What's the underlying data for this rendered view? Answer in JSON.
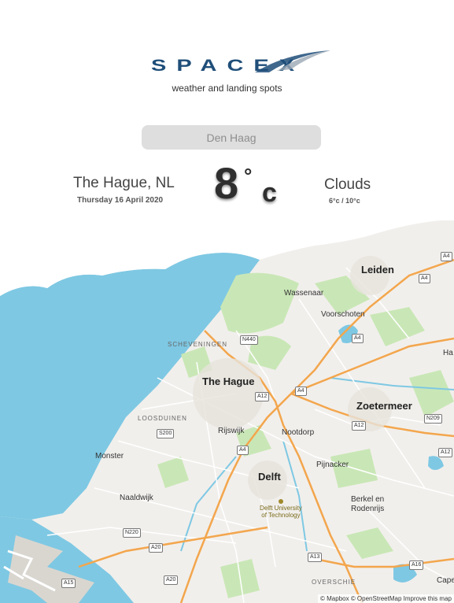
{
  "header": {
    "logo_text": "SPACEX",
    "tagline": "weather and landing spots"
  },
  "search": {
    "placeholder": "Den Haag"
  },
  "weather": {
    "city": "The Hague, NL",
    "date": "Thursday 16 April 2020",
    "temperature": "8",
    "degree_symbol": "°",
    "unit": "c",
    "condition": "Clouds",
    "range": "6°c / 10°c"
  },
  "map": {
    "cities": {
      "the_hague": "The Hague",
      "leiden": "Leiden",
      "zoetermeer": "Zoetermeer",
      "delft": "Delft"
    },
    "towns": {
      "wassenaar": "Wassenaar",
      "voorschoten": "Voorschoten",
      "rijswijk": "Rijswijk",
      "nootdorp": "Nootdorp",
      "pijnacker": "Pijnacker",
      "monster": "Monster",
      "naaldwijk": "Naaldwijk",
      "berkel": "Berkel en",
      "rodenrijs": "Rodenrijs",
      "ha": "Ha",
      "cape": "Cape"
    },
    "districts": {
      "scheveningen": "SCHEVENINGEN",
      "loosduinen": "LOOSDUINEN",
      "overschie": "OVERSCHIE"
    },
    "poi": {
      "line1": "Delft University",
      "line2": "of Technology"
    },
    "shields": {
      "a4_top_right": "A4",
      "a4_upper": "A4",
      "a4_mid": "A4",
      "a4_rijswijk": "A4",
      "n440": "N440",
      "a12_center": "A12",
      "a12_east": "A12",
      "n209": "N209",
      "s200": "S200",
      "a12_edge": "A12",
      "n220": "N220",
      "a20_1": "A20",
      "a20_2": "A20",
      "a13": "A13",
      "a16": "A16",
      "a15": "A15"
    },
    "attribution": "© Mapbox © OpenStreetMap Improve this map",
    "colors": {
      "water": "#7ec8e3",
      "land": "#f1efec",
      "park": "#c9e7b6",
      "road_major": "#f3a64d",
      "road_minor": "#ffffff"
    }
  }
}
